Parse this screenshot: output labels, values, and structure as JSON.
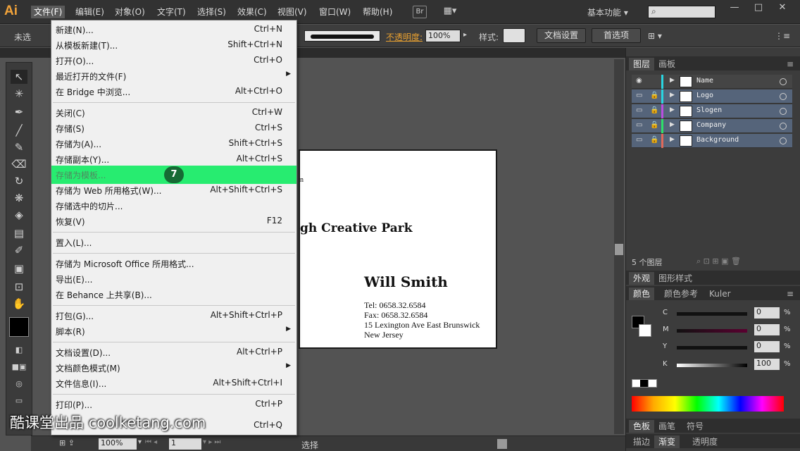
{
  "app": {
    "logo": "Ai"
  },
  "menubar": {
    "items": [
      "文件(F)",
      "编辑(E)",
      "对象(O)",
      "文字(T)",
      "选择(S)",
      "效果(C)",
      "视图(V)",
      "窗口(W)",
      "帮助(H)"
    ],
    "bridge_label": "Br",
    "workspace": "基本功能",
    "search_placeholder": "",
    "window_buttons": [
      "—",
      "□",
      "✕"
    ]
  },
  "controlbar": {
    "selection_text": "未选",
    "opacity_label": "不透明度:",
    "opacity_value": "100%",
    "style_label": "样式:",
    "doc_setup": "文档设置",
    "preferences": "首选项"
  },
  "file_menu": {
    "items": [
      {
        "label": "新建(N)...",
        "shortcut": "Ctrl+N"
      },
      {
        "label": "从模板新建(T)...",
        "shortcut": "Shift+Ctrl+N"
      },
      {
        "label": "打开(O)...",
        "shortcut": "Ctrl+O"
      },
      {
        "label": "最近打开的文件(F)",
        "shortcut": ""
      },
      {
        "label": "在 Bridge 中浏览...",
        "shortcut": "Alt+Ctrl+O"
      },
      {
        "label": "关闭(C)",
        "shortcut": "Ctrl+W"
      },
      {
        "label": "存储(S)",
        "shortcut": "Ctrl+S"
      },
      {
        "label": "存储为(A)...",
        "shortcut": "Shift+Ctrl+S"
      },
      {
        "label": "存储副本(Y)...",
        "shortcut": "Alt+Ctrl+S"
      },
      {
        "label": "存储为模板...",
        "shortcut": ""
      },
      {
        "label": "存储为 Web 所用格式(W)...",
        "shortcut": "Alt+Shift+Ctrl+S"
      },
      {
        "label": "存储选中的切片...",
        "shortcut": ""
      },
      {
        "label": "恢复(V)",
        "shortcut": "F12"
      },
      {
        "label": "置入(L)...",
        "shortcut": ""
      },
      {
        "label": "存储为 Microsoft Office 所用格式...",
        "shortcut": ""
      },
      {
        "label": "导出(E)...",
        "shortcut": ""
      },
      {
        "label": "在 Behance 上共享(B)...",
        "shortcut": ""
      },
      {
        "label": "打包(G)...",
        "shortcut": "Alt+Shift+Ctrl+P"
      },
      {
        "label": "脚本(R)",
        "shortcut": ""
      },
      {
        "label": "文档设置(D)...",
        "shortcut": "Alt+Ctrl+P"
      },
      {
        "label": "文档颜色模式(M)",
        "shortcut": ""
      },
      {
        "label": "文件信息(I)...",
        "shortcut": "Alt+Shift+Ctrl+I"
      },
      {
        "label": "打印(P)...",
        "shortcut": "Ctrl+P"
      },
      {
        "label": "",
        "shortcut": "Ctrl+Q"
      }
    ],
    "step_badge": "7"
  },
  "artboard": {
    "small_text": "n",
    "company": "gh Creative Park",
    "person": "Will Smith",
    "tel": "Tel: 0658.32.6584",
    "fax": "Fax: 0658.32.6584",
    "address1": "15 Lexington Ave East Brunswick",
    "address2": "New Jersey"
  },
  "statusbar": {
    "zoom": "100%",
    "page": "1",
    "status": "选择"
  },
  "layers_panel": {
    "tabs": [
      "图层",
      "画板"
    ],
    "layers": [
      {
        "name": "Name",
        "color": "#2ad4e0"
      },
      {
        "name": "Logo",
        "color": "#2ad4e0"
      },
      {
        "name": "Slogen",
        "color": "#b94fe0"
      },
      {
        "name": "Company",
        "color": "#2ee06a"
      },
      {
        "name": "Background",
        "color": "#e06a5a"
      }
    ],
    "count": "5 个图层"
  },
  "appearance_panel": {
    "tabs": [
      "外观",
      "图形样式"
    ]
  },
  "color_panel": {
    "tabs": [
      "颜色",
      "颜色参考",
      "Kuler"
    ],
    "channels": [
      {
        "label": "C",
        "value": "0"
      },
      {
        "label": "M",
        "value": "0"
      },
      {
        "label": "Y",
        "value": "0"
      },
      {
        "label": "K",
        "value": "100"
      }
    ],
    "percent": "%"
  },
  "bottom_panels": {
    "row1": [
      "色板",
      "画笔",
      "符号"
    ],
    "row2": [
      "描边",
      "渐变",
      "透明度"
    ]
  },
  "watermark": "酷课堂出品 coolketang.com"
}
